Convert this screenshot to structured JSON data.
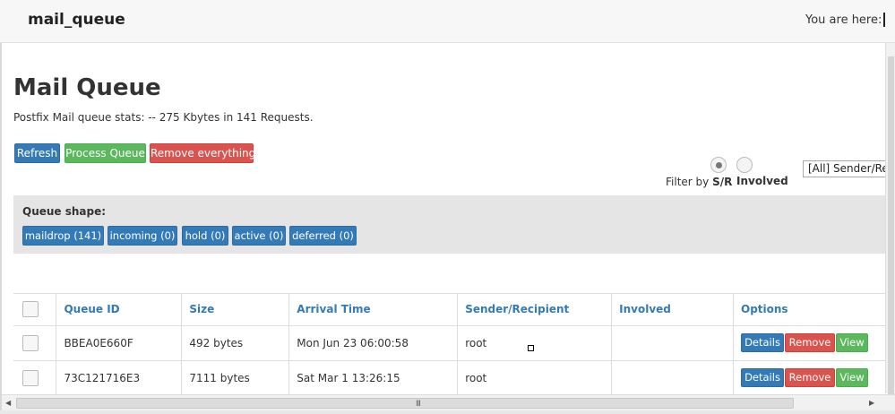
{
  "header": {
    "app_title": "mail_queue",
    "breadcrumb_label": "You are here:"
  },
  "main": {
    "title": "Mail Queue",
    "stats": "Postfix Mail queue stats: -- 275 Kbytes in 141 Requests.",
    "toolbar": {
      "refresh_label": "Refresh",
      "process_label": "Process Queue",
      "remove_all_label": "Remove everything"
    },
    "filter": {
      "prefix": "Filter by",
      "option_sr": "S/R",
      "option_involved": "Involved",
      "selected": "S/R",
      "select_value": "[All] Sender/Recipient"
    },
    "queue_shape": {
      "label": "Queue shape:",
      "buttons": [
        "maildrop (141)",
        "incoming (0)",
        "hold (0)",
        "active (0)",
        "deferred (0)"
      ]
    },
    "table": {
      "columns": [
        "Queue ID",
        "Size",
        "Arrival Time",
        "Sender/Recipient",
        "Involved",
        "Options"
      ],
      "rows": [
        {
          "queue_id": "BBEA0E660F",
          "size": "492 bytes",
          "arrival": "Mon Jun 23 06:00:58",
          "sender": "root",
          "involved": ""
        },
        {
          "queue_id": "73C121716E3",
          "size": "7111 bytes",
          "arrival": "Sat Mar 1 13:26:15",
          "sender": "root",
          "involved": ""
        }
      ],
      "option_labels": {
        "details": "Details",
        "remove": "Remove",
        "view": "View"
      }
    }
  },
  "scrollbars": {
    "h_grip": "III"
  },
  "colors": {
    "primary": "#337ab7",
    "success": "#5cb85c",
    "danger": "#d9534f",
    "panel_bg": "#e5e5e5"
  }
}
